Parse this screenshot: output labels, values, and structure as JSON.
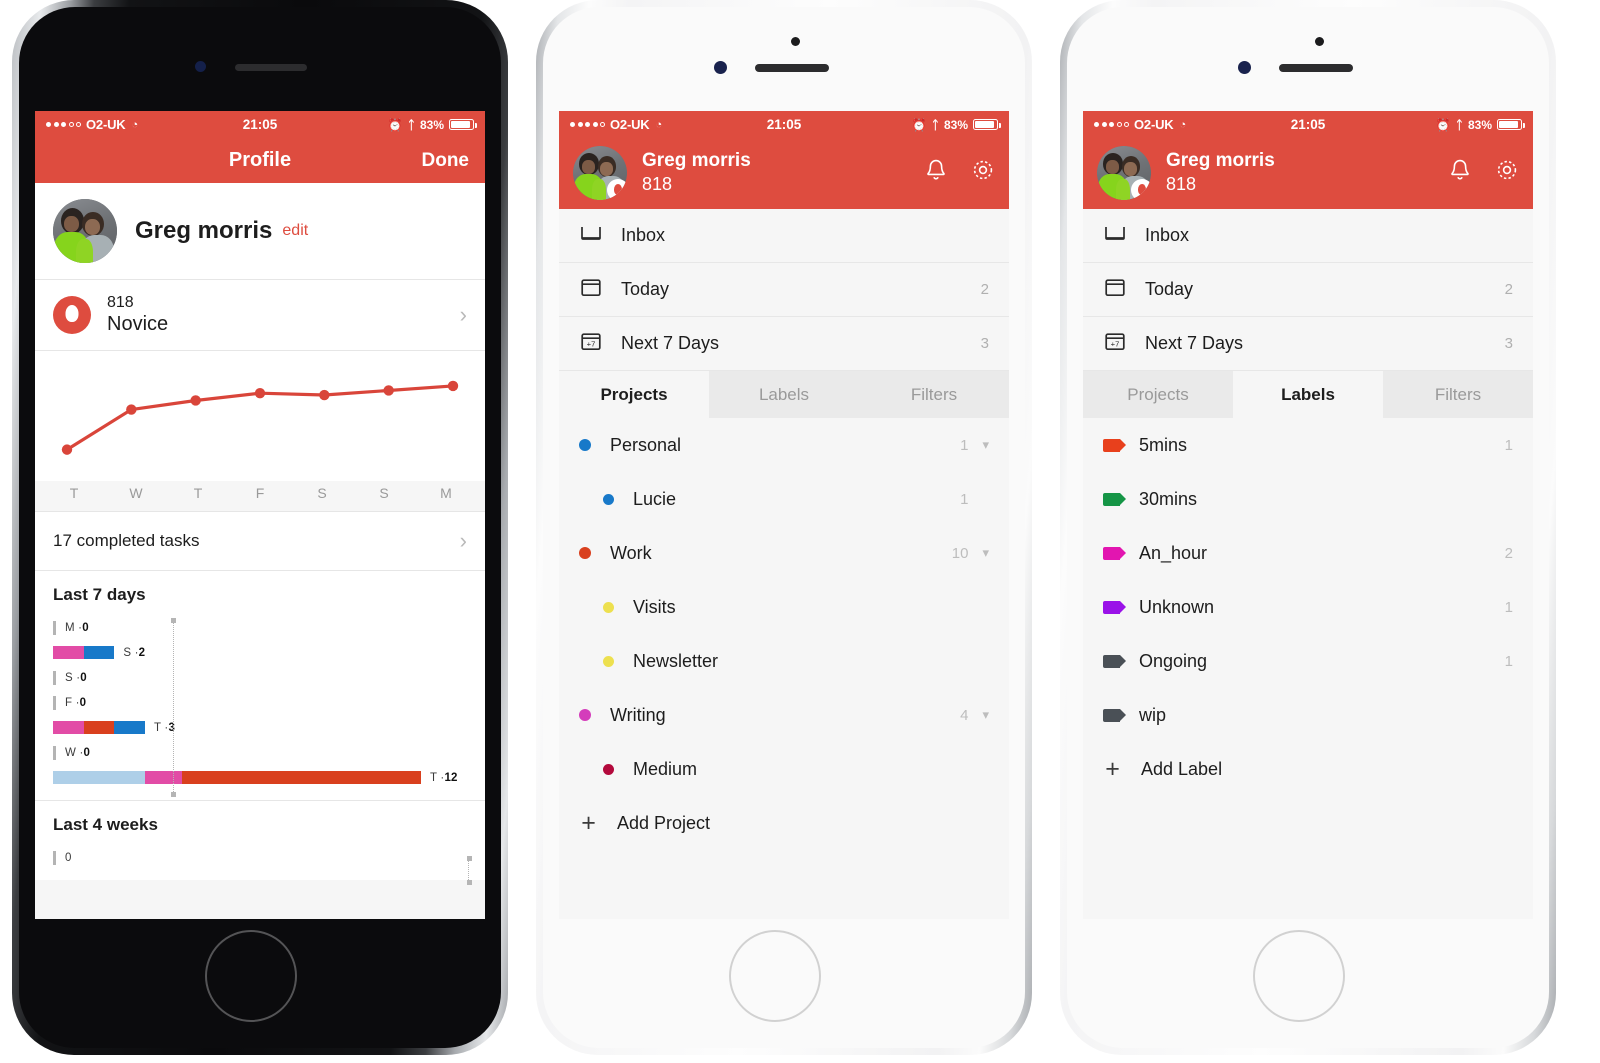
{
  "status_bar": {
    "carrier": "O2-UK",
    "time": "21:05",
    "battery_pct": "83%",
    "signal_dots_filled": 3,
    "signal_dots_total": 5,
    "wifi_icon": "wifi-icon",
    "alarm_icon": "alarm-icon",
    "bluetooth_icon": "bluetooth-icon"
  },
  "phone1": {
    "navbar": {
      "title": "Profile",
      "done_label": "Done"
    },
    "profile": {
      "name": "Greg morris",
      "edit_label": "edit",
      "avatar": "user-avatar"
    },
    "karma": {
      "points": "818",
      "level": "Novice",
      "chevron": "chevron-right-icon"
    },
    "completed": {
      "label": "17 completed tasks",
      "chevron": "chevron-right-icon"
    },
    "last7": {
      "title": "Last 7 days"
    },
    "last4": {
      "title": "Last 4 weeks",
      "first_label": "0"
    },
    "chart_data": [
      {
        "type": "line",
        "title": "Karma trend",
        "categories": [
          "T",
          "W",
          "T",
          "F",
          "S",
          "S",
          "M"
        ],
        "values": [
          18,
          62,
          72,
          80,
          78,
          83,
          88
        ],
        "ylim": [
          0,
          100
        ],
        "series_color": "#D9453A",
        "grid": false,
        "legend": "none",
        "xlabel": "",
        "ylabel": ""
      },
      {
        "type": "bar",
        "title": "Last 7 days",
        "orientation": "horizontal",
        "categories": [
          "M",
          "S",
          "S",
          "F",
          "T",
          "W",
          "T"
        ],
        "values": [
          0,
          2,
          0,
          0,
          3,
          0,
          12
        ],
        "labels": [
          "M · 0",
          "S · 2",
          "S · 0",
          "F · 0",
          "T · 3",
          "W · 0",
          "T · 12"
        ],
        "average_marker": 3.9,
        "xlim": [
          0,
          12
        ],
        "stacks": [
          {
            "day": "M",
            "total": 0,
            "segments": []
          },
          {
            "day": "S",
            "total": 2,
            "segments": [
              {
                "color": "#E24CA6",
                "value": 1
              },
              {
                "color": "#1879C9",
                "value": 1
              }
            ]
          },
          {
            "day": "S",
            "total": 0,
            "segments": []
          },
          {
            "day": "F",
            "total": 0,
            "segments": []
          },
          {
            "day": "T",
            "total": 3,
            "segments": [
              {
                "color": "#E24CA6",
                "value": 1
              },
              {
                "color": "#D9401E",
                "value": 1
              },
              {
                "color": "#1879C9",
                "value": 1
              }
            ]
          },
          {
            "day": "W",
            "total": 0,
            "segments": []
          },
          {
            "day": "T",
            "total": 12,
            "segments": [
              {
                "color": "#AECFE8",
                "value": 3
              },
              {
                "color": "#E24CA6",
                "value": 1.2
              },
              {
                "color": "#D9401E",
                "value": 7.8
              }
            ]
          }
        ]
      },
      {
        "type": "bar",
        "title": "Last 4 weeks",
        "orientation": "horizontal",
        "categories": [
          ""
        ],
        "values": [
          0
        ],
        "labels": [
          "0"
        ]
      }
    ]
  },
  "phone2": {
    "header": {
      "name": "Greg morris",
      "points": "818",
      "bell_icon": "bell-icon",
      "gear_icon": "gear-icon"
    },
    "nav": [
      {
        "label": "Inbox",
        "count": "",
        "icon": "inbox-icon"
      },
      {
        "label": "Today",
        "count": "2",
        "icon": "calendar-icon"
      },
      {
        "label": "Next 7 Days",
        "count": "3",
        "icon": "calendar-7-icon"
      }
    ],
    "tabs": [
      {
        "label": "Projects",
        "active": true
      },
      {
        "label": "Labels",
        "active": false
      },
      {
        "label": "Filters",
        "active": false
      }
    ],
    "projects": [
      {
        "label": "Personal",
        "color": "#1879C9",
        "count": "1",
        "sub": false,
        "chevron": true
      },
      {
        "label": "Lucie",
        "color": "#1879C9",
        "count": "1",
        "sub": true,
        "chevron": false
      },
      {
        "label": "Work",
        "color": "#D9401E",
        "count": "10",
        "sub": false,
        "chevron": true
      },
      {
        "label": "Visits",
        "color": "#EDE04F",
        "count": "",
        "sub": true,
        "chevron": false
      },
      {
        "label": "Newsletter",
        "color": "#EDE04F",
        "count": "",
        "sub": true,
        "chevron": false
      },
      {
        "label": "Writing",
        "color": "#D43DBB",
        "count": "4",
        "sub": false,
        "chevron": true
      },
      {
        "label": "Medium",
        "color": "#B3093C",
        "count": "",
        "sub": true,
        "chevron": false
      }
    ],
    "add_label": "Add Project"
  },
  "phone3": {
    "header": {
      "name": "Greg morris",
      "points": "818",
      "bell_icon": "bell-icon",
      "gear_icon": "gear-icon"
    },
    "nav": [
      {
        "label": "Inbox",
        "count": "",
        "icon": "inbox-icon"
      },
      {
        "label": "Today",
        "count": "2",
        "icon": "calendar-icon"
      },
      {
        "label": "Next 7 Days",
        "count": "3",
        "icon": "calendar-7-icon"
      }
    ],
    "tabs": [
      {
        "label": "Projects",
        "active": false
      },
      {
        "label": "Labels",
        "active": true
      },
      {
        "label": "Filters",
        "active": false
      }
    ],
    "labels": [
      {
        "label": "5mins",
        "color": "#E8401C",
        "count": "1"
      },
      {
        "label": "30mins",
        "color": "#159546",
        "count": ""
      },
      {
        "label": "An_hour",
        "color": "#E215B0",
        "count": "2"
      },
      {
        "label": "Unknown",
        "color": "#9A12E8",
        "count": "1"
      },
      {
        "label": "Ongoing",
        "color": "#4A5056",
        "count": "1"
      },
      {
        "label": "wip",
        "color": "#4A5056",
        "count": ""
      }
    ],
    "add_label": "Add Label"
  },
  "theme": {
    "accent": "#DE4C3F",
    "screen_bg": "#f6f6f6",
    "tab_inactive_bg": "#eaeaea"
  }
}
